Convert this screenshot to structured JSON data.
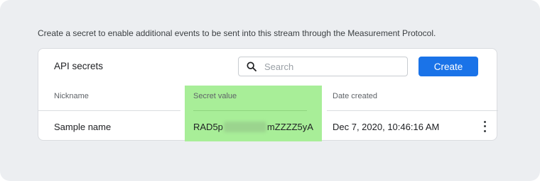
{
  "intro_text": "Create a secret to enable additional events to be sent into this stream through the Measurement Protocol.",
  "card": {
    "title": "API secrets",
    "search": {
      "placeholder": "Search",
      "value": ""
    },
    "create_label": "Create"
  },
  "table": {
    "columns": [
      "Nickname",
      "Secret value",
      "Date created"
    ],
    "rows": [
      {
        "nickname": "Sample name",
        "secret_prefix": "RAD5p",
        "secret_suffix": "mZZZZ5yA",
        "date_created": "Dec 7, 2020, 10:46:16 AM"
      }
    ]
  },
  "colors": {
    "accent": "#1a73e8",
    "highlight": "#a8ee98",
    "background": "#eceef1"
  },
  "icons": {
    "search": "search-icon",
    "more": "more-vert-icon"
  }
}
